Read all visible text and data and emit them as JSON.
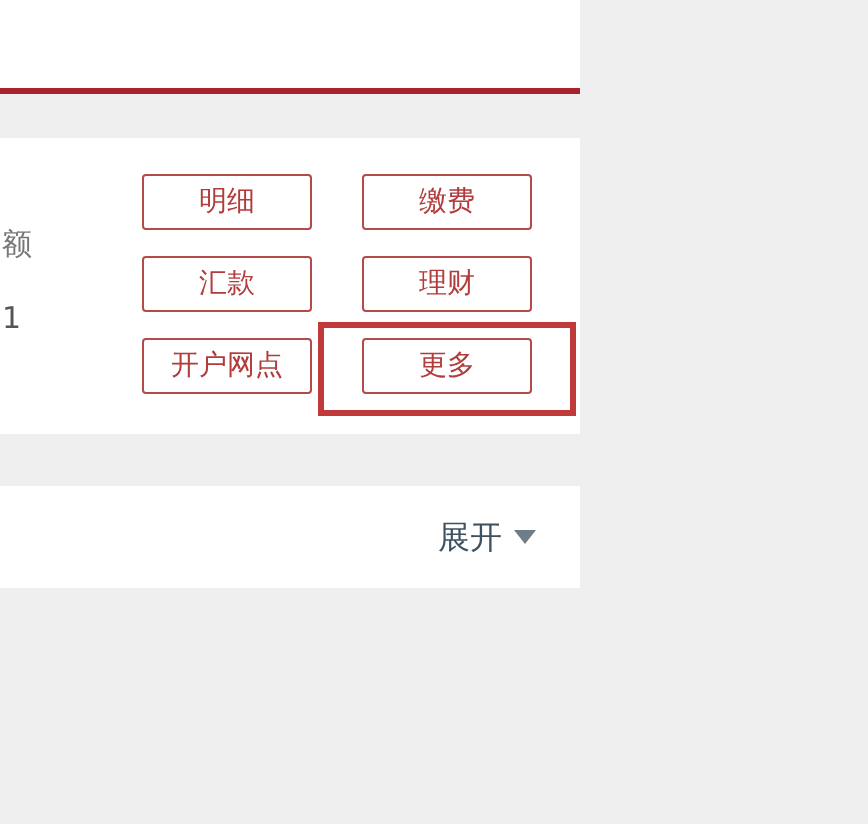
{
  "account_card": {
    "label": "额",
    "value": "1"
  },
  "actions": [
    {
      "label": "明细",
      "highlighted": false
    },
    {
      "label": "缴费",
      "highlighted": false
    },
    {
      "label": "汇款",
      "highlighted": false
    },
    {
      "label": "理财",
      "highlighted": false
    },
    {
      "label": "开户网点",
      "highlighted": false
    },
    {
      "label": "更多",
      "highlighted": true
    }
  ],
  "expand": {
    "label": "展开"
  }
}
